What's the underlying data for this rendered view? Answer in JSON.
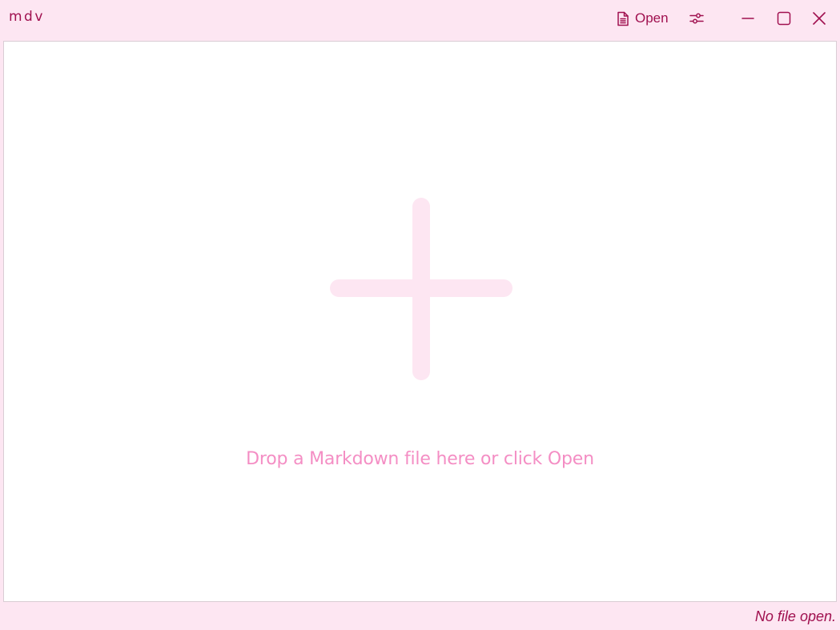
{
  "window": {
    "app_title": "mdv"
  },
  "toolbar": {
    "open_label": "Open",
    "open_icon": "document-icon",
    "settings_icon": "sliders-icon",
    "minimize_icon": "minimize-icon",
    "maximize_icon": "maximize-icon",
    "close_icon": "close-icon"
  },
  "drop_area": {
    "icon": "plus-icon",
    "hint": "Drop a Markdown file here or click Open"
  },
  "status": {
    "text": "No file open."
  },
  "colors": {
    "chrome_background": "#fde6f2",
    "accent": "#a0104f",
    "hint_text": "#f48ec4",
    "plus_icon": "#fde6f2",
    "content_background": "#ffffff"
  }
}
